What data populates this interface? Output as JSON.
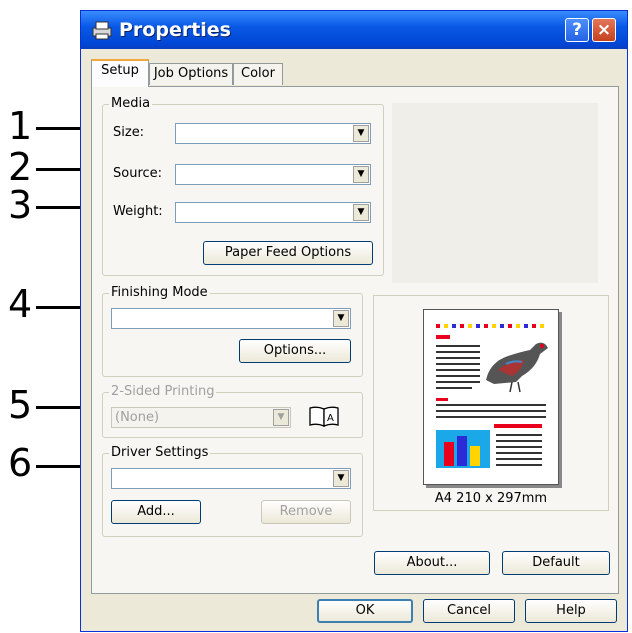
{
  "window": {
    "title": "Properties",
    "help_label": "?",
    "close_label": "×"
  },
  "tabs": [
    {
      "label": "Setup",
      "active": true
    },
    {
      "label": "Job Options",
      "active": false
    },
    {
      "label": "Color",
      "active": false
    }
  ],
  "media": {
    "legend": "Media",
    "size_label": "Size:",
    "source_label": "Source:",
    "weight_label": "Weight:",
    "size_value": "",
    "source_value": "",
    "weight_value": "",
    "paper_feed_button": "Paper Feed Options"
  },
  "finishing": {
    "legend": "Finishing Mode",
    "value": "",
    "options_button": "Options..."
  },
  "two_sided": {
    "legend": "2-Sided Printing",
    "value": "(None)"
  },
  "driver": {
    "legend": "Driver Settings",
    "value": "",
    "add_button": "Add...",
    "remove_button": "Remove"
  },
  "preview": {
    "paper_size": "A4 210 x 297mm"
  },
  "buttons": {
    "about": "About...",
    "default": "Default",
    "ok": "OK",
    "cancel": "Cancel",
    "help": "Help"
  },
  "callouts": [
    "1",
    "2",
    "3",
    "4",
    "5",
    "6"
  ],
  "colors": {
    "title_bar": "#0a5ae6",
    "dialog_bg": "#ece9d8",
    "tab_accent": "#f0a73c"
  }
}
